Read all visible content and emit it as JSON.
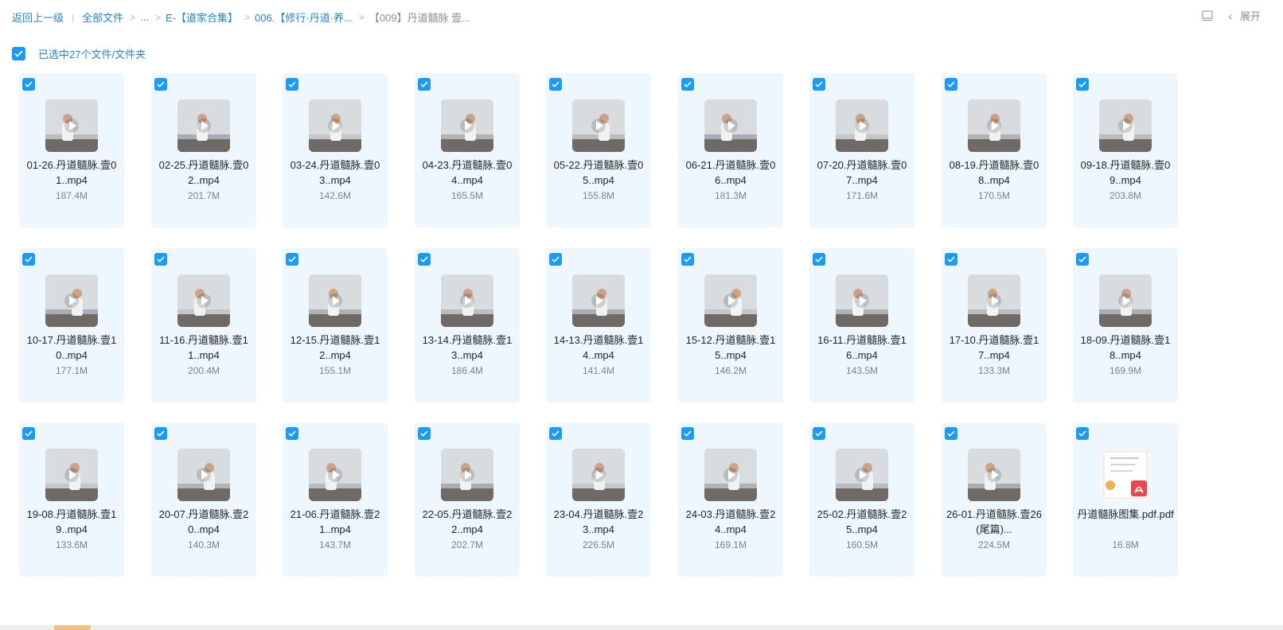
{
  "breadcrumb": {
    "back": "返回上一级",
    "items": [
      "全部文件",
      "...",
      "E-【道家合集】",
      "006.【修行·丹道·养...",
      "【009】丹道髓脉 壹..."
    ]
  },
  "toolbar": {
    "expand_label": "展开"
  },
  "selection": {
    "text": "已选中27个文件/文件夹"
  },
  "files": [
    {
      "name": "01-26.丹道髓脉.壹01..mp4",
      "size": "187.4M",
      "type": "video"
    },
    {
      "name": "02-25.丹道髓脉.壹02..mp4",
      "size": "201.7M",
      "type": "video"
    },
    {
      "name": "03-24.丹道髓脉.壹03..mp4",
      "size": "142.6M",
      "type": "video"
    },
    {
      "name": "04-23.丹道髓脉.壹04..mp4",
      "size": "165.5M",
      "type": "video"
    },
    {
      "name": "05-22.丹道髓脉.壹05..mp4",
      "size": "155.8M",
      "type": "video"
    },
    {
      "name": "06-21.丹道髓脉.壹06..mp4",
      "size": "181.3M",
      "type": "video"
    },
    {
      "name": "07-20.丹道髓脉.壹07..mp4",
      "size": "171.6M",
      "type": "video"
    },
    {
      "name": "08-19.丹道髓脉.壹08..mp4",
      "size": "170.5M",
      "type": "video"
    },
    {
      "name": "09-18.丹道髓脉.壹09..mp4",
      "size": "203.8M",
      "type": "video"
    },
    {
      "name": "10-17.丹道髓脉.壹10..mp4",
      "size": "177.1M",
      "type": "video"
    },
    {
      "name": "11-16.丹道髓脉.壹11..mp4",
      "size": "200.4M",
      "type": "video"
    },
    {
      "name": "12-15.丹道髓脉.壹12..mp4",
      "size": "155.1M",
      "type": "video"
    },
    {
      "name": "13-14.丹道髓脉.壹13..mp4",
      "size": "186.4M",
      "type": "video"
    },
    {
      "name": "14-13.丹道髓脉.壹14..mp4",
      "size": "141.4M",
      "type": "video"
    },
    {
      "name": "15-12.丹道髓脉.壹15..mp4",
      "size": "146.2M",
      "type": "video"
    },
    {
      "name": "16-11.丹道髓脉.壹16..mp4",
      "size": "143.5M",
      "type": "video"
    },
    {
      "name": "17-10.丹道髓脉.壹17..mp4",
      "size": "133.3M",
      "type": "video"
    },
    {
      "name": "18-09.丹道髓脉.壹18..mp4",
      "size": "169.9M",
      "type": "video"
    },
    {
      "name": "19-08.丹道髓脉.壹19..mp4",
      "size": "133.6M",
      "type": "video"
    },
    {
      "name": "20-07.丹道髓脉.壹20..mp4",
      "size": "140.3M",
      "type": "video"
    },
    {
      "name": "21-06.丹道髓脉.壹21..mp4",
      "size": "143.7M",
      "type": "video"
    },
    {
      "name": "22-05.丹道髓脉.壹22..mp4",
      "size": "202.7M",
      "type": "video"
    },
    {
      "name": "23-04.丹道髓脉.壹23..mp4",
      "size": "226.5M",
      "type": "video"
    },
    {
      "name": "24-03.丹道髓脉.壹24..mp4",
      "size": "169.1M",
      "type": "video"
    },
    {
      "name": "25-02.丹道髓脉.壹25..mp4",
      "size": "160.5M",
      "type": "video"
    },
    {
      "name": "26-01.丹道髓脉.壹26(尾篇)...",
      "size": "224.5M",
      "type": "video"
    },
    {
      "name": "丹道髓脉图集.pdf.pdf",
      "size": "16.8M",
      "type": "pdf"
    }
  ],
  "colors": {
    "accent": "#1b9af7",
    "link": "#2a84c6",
    "card_bg": "#eef7fe",
    "pdf_red": "#e8474e"
  }
}
